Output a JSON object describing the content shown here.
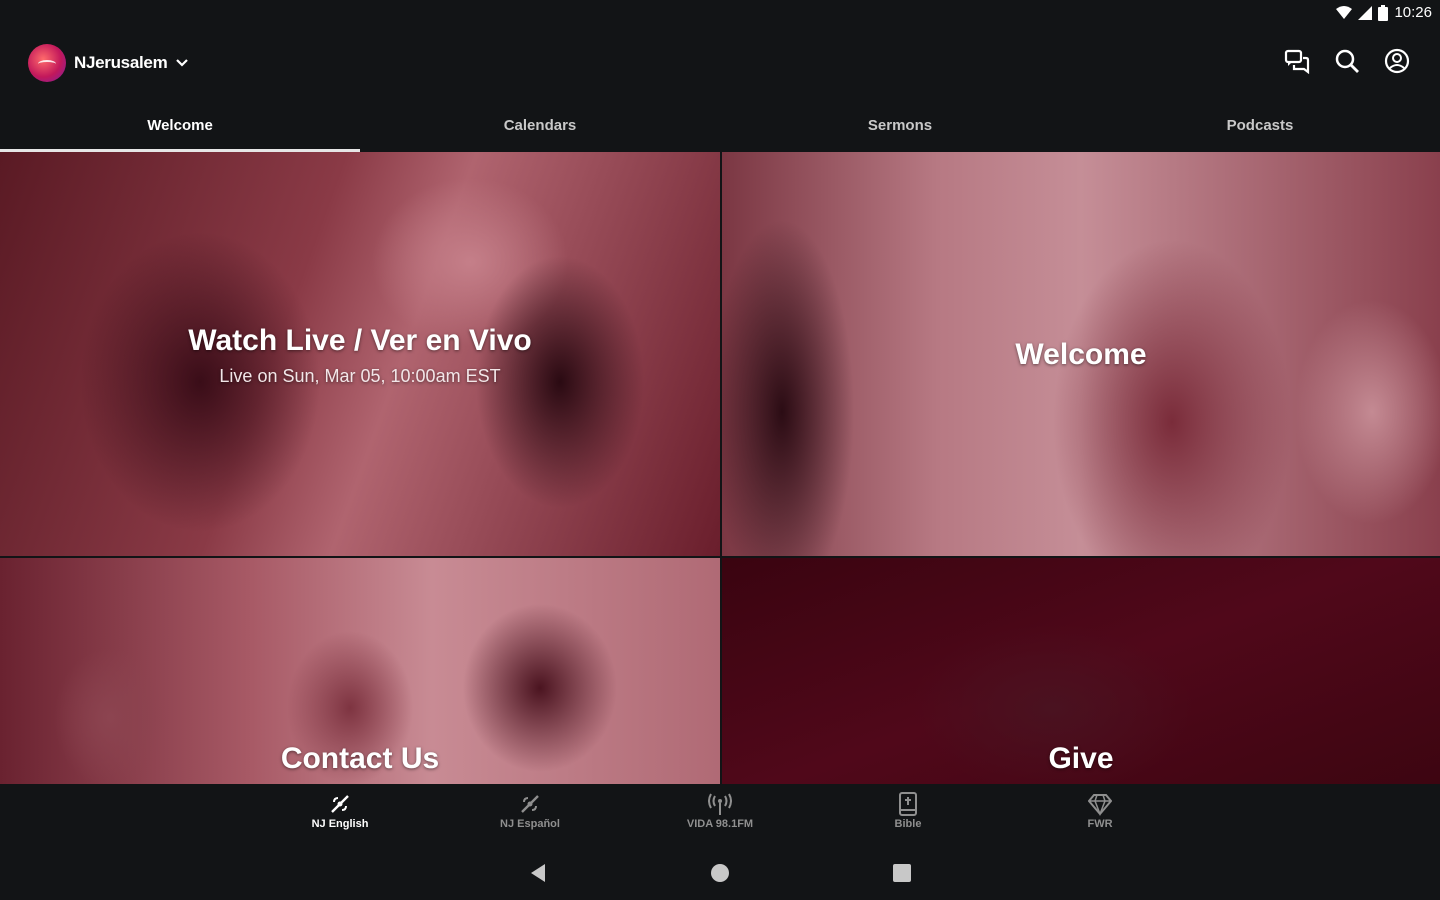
{
  "status": {
    "time": "10:26"
  },
  "app": {
    "name": "NJerusalem"
  },
  "tabs": [
    {
      "label": "Welcome",
      "active": true
    },
    {
      "label": "Calendars",
      "active": false
    },
    {
      "label": "Sermons",
      "active": false
    },
    {
      "label": "Podcasts",
      "active": false
    }
  ],
  "cards": [
    {
      "title": "Watch Live / Ver en Vivo",
      "subtitle": "Live on Sun, Mar 05, 10:00am EST"
    },
    {
      "title": "Welcome"
    },
    {
      "title": "Contact Us"
    },
    {
      "title": "Give"
    }
  ],
  "bottom_nav": [
    {
      "label": "NJ English",
      "icon": "broadcast-icon",
      "active": true
    },
    {
      "label": "NJ Español",
      "icon": "broadcast-icon",
      "active": false
    },
    {
      "label": "VIDA 98.1FM",
      "icon": "radio-tower-icon",
      "active": false
    },
    {
      "label": "Bible",
      "icon": "bible-icon",
      "active": false
    },
    {
      "label": "FWR",
      "icon": "diamond-icon",
      "active": false
    }
  ],
  "colors": {
    "background": "#121416",
    "overlay": "#8a2a3a",
    "active_tab_indicator": "#e6e6e6"
  }
}
